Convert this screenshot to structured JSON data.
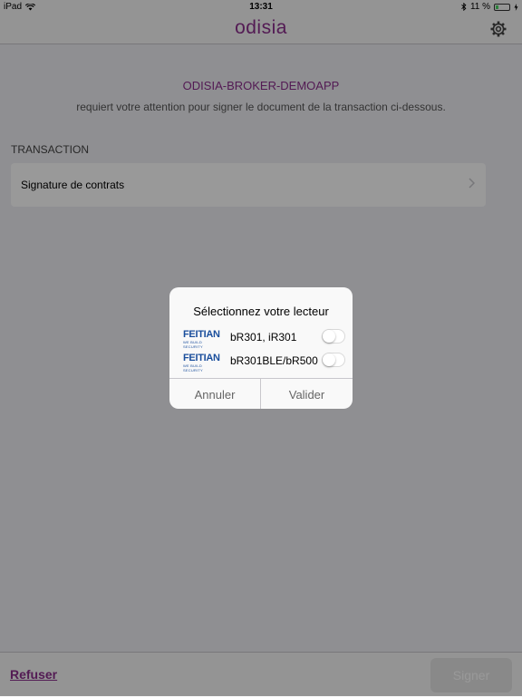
{
  "status": {
    "device": "iPad",
    "time": "13:31",
    "battery": "11 %"
  },
  "nav": {
    "logo": "odisia"
  },
  "content": {
    "app_name": "ODISIA-BROKER-DEMOAPP",
    "subtitle": "requiert votre attention pour signer le document de la transaction ci-dessous.",
    "section_header": "TRANSACTION",
    "cell_label": "Signature de contrats"
  },
  "bottom": {
    "refuse_label": "Refuser",
    "sign_label": "Signer"
  },
  "dialog": {
    "title": "Sélectionnez votre lecteur",
    "readers": [
      {
        "brand": "FEITIAN",
        "tagline": "WE BUILD SECURITY",
        "label": "bR301, iR301",
        "enabled": false
      },
      {
        "brand": "FEITIAN",
        "tagline": "WE BUILD SECURITY",
        "label": "bR301BLE/bR500",
        "enabled": false
      }
    ],
    "cancel_label": "Annuler",
    "confirm_label": "Valider"
  },
  "colors": {
    "brand": "#8b2d8c",
    "feitian_blue": "#1a4e9c",
    "battery_green": "#4cd964"
  }
}
